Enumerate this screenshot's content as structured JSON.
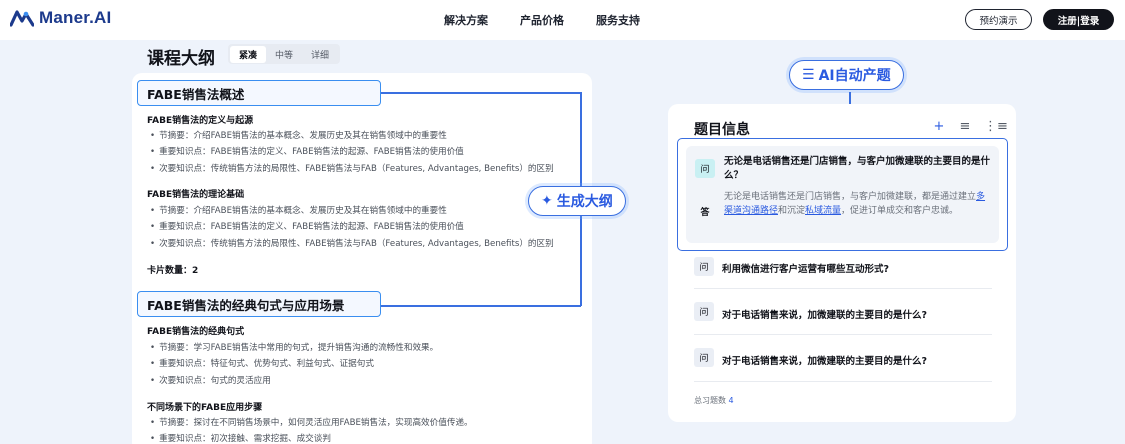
{
  "brand": {
    "name": "Maner.AI",
    "color": "#1c3a8c"
  },
  "nav": {
    "links": [
      "解决方案",
      "产品价格",
      "服务支持"
    ],
    "demo_label": "预约演示",
    "login_label": "注册|登录"
  },
  "outline": {
    "title": "课程大纲",
    "modes": [
      "紧凑",
      "中等",
      "详细"
    ],
    "active_mode": "紧凑",
    "sections": [
      {
        "title": "FABE销售法概述",
        "groups": [
          {
            "title": "FABE销售法的定义与起源",
            "items": [
              "节摘要：介绍FABE销售法的基本概念、发展历史及其在销售领域中的重要性",
              "重要知识点：FABE销售法的定义、FABE销售法的起源、FABE销售法的使用价值",
              "次要知识点：传统销售方法的局限性、FABE销售法与FAB（Features, Advantages, Benefits）的区别"
            ]
          },
          {
            "title": "FABE销售法的理论基础",
            "items": [
              "节摘要：介绍FABE销售法的基本概念、发展历史及其在销售领域中的重要性",
              "重要知识点：FABE销售法的定义、FABE销售法的起源、FABE销售法的使用价值",
              "次要知识点：传统销售方法的局限性、FABE销售法与FAB（Features, Advantages, Benefits）的区别"
            ]
          }
        ],
        "card_count": "卡片数量：2"
      },
      {
        "title": "FABE销售法的经典句式与应用场景",
        "groups": [
          {
            "title": "FABE销售法的经典句式",
            "items": [
              "节摘要：学习FABE销售法中常用的句式，提升销售沟通的流畅性和效果。",
              "重要知识点：特征句式、优势句式、利益句式、证据句式",
              "次要知识点：句式的灵活应用"
            ]
          },
          {
            "title": "不同场景下的FABE应用步骤",
            "items": [
              "节摘要：探讨在不同销售场景中，如何灵活应用FABE销售法，实现高效价值传递。",
              "重要知识点：初次接触、需求挖掘、成交谈判"
            ]
          }
        ]
      }
    ]
  },
  "pills": {
    "generate_outline": "生成大纲",
    "ai_questions": "AI自动产题"
  },
  "questions": {
    "title": "题目信息",
    "q_tag": "问",
    "a_tag": "答",
    "selected": {
      "question": "无论是电话销售还是门店销售，与客户加微建联的主要目的是什么？",
      "answer_parts": [
        {
          "text": "无论是电话销售还是门店销售，与客户加微建联，都是通过建立",
          "link": false
        },
        {
          "text": "多渠道沟通路径",
          "link": true
        },
        {
          "text": "和沉淀",
          "link": false
        },
        {
          "text": "私域流量",
          "link": true
        },
        {
          "text": "，促进订单成交和客户忠诚。",
          "link": false
        }
      ]
    },
    "others": [
      "利用微信进行客户运营有哪些互动形式?",
      "对于电话销售来说，加微建联的主要目的是什么?",
      "对于电话销售来说，加微建联的主要目的是什么?"
    ],
    "total_label": "总习题数",
    "total_count": "4"
  },
  "colors": {
    "accent": "#2a5ae0",
    "border": "#3a6fe0",
    "bg": "#eef3fb"
  }
}
